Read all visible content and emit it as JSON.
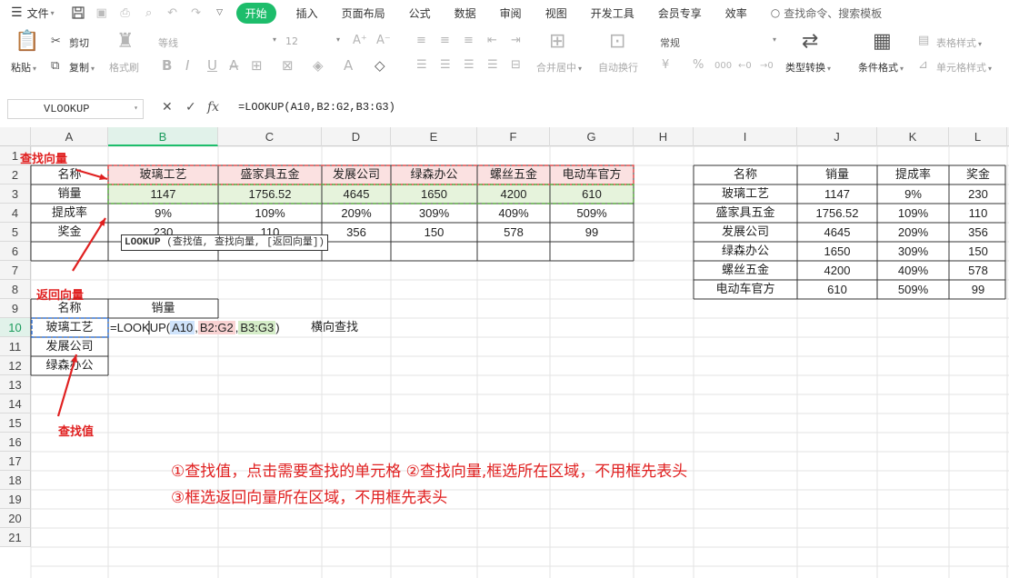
{
  "menubar": {
    "file": "文件",
    "tabs": [
      "开始",
      "插入",
      "页面布局",
      "公式",
      "数据",
      "审阅",
      "视图",
      "开发工具",
      "会员专享",
      "效率"
    ],
    "active_tab": "开始",
    "search": "查找命令、搜索模板"
  },
  "ribbon": {
    "paste": "粘贴",
    "cut": "剪切",
    "copy": "复制",
    "format_painter": "格式刷",
    "font_name": "等线",
    "font_size": "12",
    "merge_center": "合并居中",
    "wrap": "自动换行",
    "number_format": "常规",
    "type_convert": "类型转换",
    "cond_format": "条件格式",
    "table_style": "表格样式",
    "cell_style": "单元格样式"
  },
  "formula_bar": {
    "name_box": "VLOOKUP",
    "formula": "=LOOKUP(A10,B2:G2,B3:G3)"
  },
  "grid": {
    "columns": [
      "A",
      "B",
      "C",
      "D",
      "E",
      "F",
      "G",
      "H",
      "I",
      "J",
      "K",
      "L"
    ],
    "selected_column": "B",
    "rows": [
      "1",
      "2",
      "3",
      "4",
      "5",
      "6",
      "7",
      "8",
      "9",
      "10",
      "11",
      "12",
      "13",
      "14",
      "15",
      "16",
      "17",
      "18",
      "19",
      "20",
      "21"
    ],
    "selected_row": "10"
  },
  "table1": {
    "header": [
      "名称",
      "玻璃工艺",
      "盛家具五金",
      "发展公司",
      "绿森办公",
      "螺丝五金",
      "电动车官方"
    ],
    "sales": [
      "销量",
      "1147",
      "1756.52",
      "4645",
      "1650",
      "4200",
      "610"
    ],
    "rate": [
      "提成率",
      "9%",
      "109%",
      "209%",
      "309%",
      "409%",
      "509%"
    ],
    "bonus": [
      "奖金",
      "230",
      "110",
      "356",
      "150",
      "578",
      "99"
    ]
  },
  "table2": {
    "headers": [
      "名称",
      "销量",
      "提成率",
      "奖金"
    ],
    "rows": [
      [
        "玻璃工艺",
        "1147",
        "9%",
        "230"
      ],
      [
        "盛家具五金",
        "1756.52",
        "109%",
        "110"
      ],
      [
        "发展公司",
        "4645",
        "209%",
        "356"
      ],
      [
        "绿森办公",
        "1650",
        "309%",
        "150"
      ],
      [
        "螺丝五金",
        "4200",
        "409%",
        "578"
      ],
      [
        "电动车官方",
        "610",
        "509%",
        "99"
      ]
    ]
  },
  "table3": {
    "header_name": "名称",
    "header_sales": "销量",
    "names": [
      "玻璃工艺",
      "发展公司",
      "绿森办公"
    ],
    "formula_prefix": "=LOOKUP(",
    "arg1": "A10",
    "sep": ",",
    "arg2": "B2:G2",
    "arg3": "B3:G3",
    "formula_suffix": ")",
    "side_label": "横向查找"
  },
  "tooltip": {
    "fn": "LOOKUP",
    "args": "(查找值, 查找向量, [返回向量])"
  },
  "annotations": {
    "lookup_vector": "查找向量",
    "return_vector": "返回向量",
    "lookup_value": "查找值",
    "note1": "①查找值，点击需要查找的单元格 ②查找向量,框选所在区域，不用框先表头",
    "note2": "③框选返回向量所在区域，不用框先表头"
  },
  "colors": {
    "accent_green": "#1dbd6b",
    "annotation_red": "#e02020",
    "lookup_vector_fill": "#fbe1e1",
    "return_vector_fill": "#e6f3dc"
  }
}
